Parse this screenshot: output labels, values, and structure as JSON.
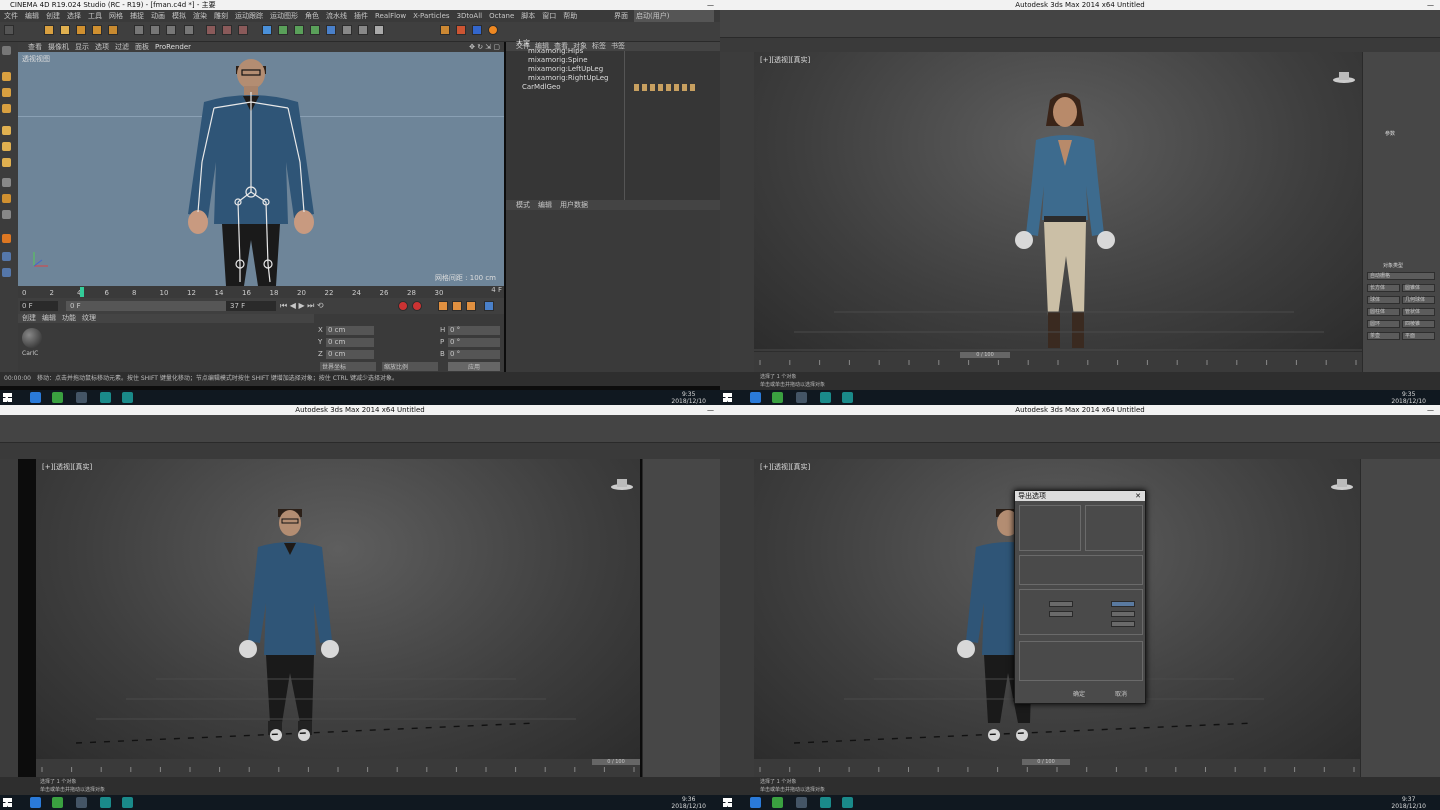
{
  "c4d": {
    "title": "CINEMA 4D R19.024 Studio (RC - R19) - [fman.c4d *] - 主要",
    "menu": [
      "文件",
      "编辑",
      "创建",
      "选择",
      "工具",
      "网格",
      "捕捉",
      "动画",
      "模拟",
      "渲染",
      "雕刻",
      "运动跟踪",
      "运动图形",
      "角色",
      "流水线",
      "插件",
      "RealFlow",
      "X-Particles",
      "3DtoAll",
      "Octane",
      "脚本",
      "窗口",
      "帮助"
    ],
    "layout_label": "界面",
    "layout_value": "启动(用户)",
    "viewport_menu": [
      "查看",
      "摄像机",
      "显示",
      "选项",
      "过滤",
      "面板",
      "ProRender"
    ],
    "viewport_name": "透视视图",
    "grid_spacing": "网格间距 : 100 cm",
    "timeline_ticks": [
      "0",
      "2",
      "4",
      "6",
      "8",
      "10",
      "12",
      "14",
      "16",
      "18",
      "20",
      "22",
      "24",
      "26",
      "28",
      "30"
    ],
    "timeline_end": "4 F",
    "frame_start": "0 F",
    "frame_cur": "0 F",
    "frame_end": "37 F",
    "objects_menu": [
      "文件",
      "编辑",
      "查看",
      "对象",
      "标签",
      "书签"
    ],
    "objects": [
      "大宝",
      "mixamorig:Hips",
      "mixamorig:Spine",
      "mixamorig:LeftUpLeg",
      "mixamorig:RightUpLeg",
      "CarMdlGeo"
    ],
    "attr_menu": [
      "模式",
      "编辑",
      "用户数据"
    ],
    "material_menu": [
      "创建",
      "编辑",
      "功能",
      "纹理"
    ],
    "material_name": "CarIC",
    "coords": {
      "x": "0 cm",
      "y": "0 cm",
      "z": "0 cm",
      "h": "0 °",
      "p": "0 °",
      "b": "0 °"
    },
    "coord_mode1": "世界坐标",
    "coord_mode2": "缩放比例",
    "apply": "应用",
    "status_time": "00:00:00",
    "status_text": "移动：点击并拖动鼠标移动元素。按住 SHIFT 键量化移动；节点编辑模式时按住 SHIFT 键增加选择对象；按住 CTRL 键减少选择对象。",
    "clock_time": "9:35",
    "clock_date": "2018/12/10"
  },
  "max_tr": {
    "title": "Autodesk 3ds Max 2014 x64    Untitled",
    "viewport_label": "[+][透视][真实]",
    "cmd_panel": [
      "参数",
      "对象类型",
      "自动栅格",
      "长方体",
      "圆锥体",
      "球体",
      "几何球体",
      "圆柱体",
      "管状体",
      "圆环",
      "四棱锥",
      "茶壶",
      "平面"
    ],
    "track_ticks": [
      "0",
      "5",
      "10",
      "15",
      "20",
      "25",
      "30",
      "35",
      "40",
      "45",
      "50",
      "55",
      "60",
      "65",
      "70",
      "75",
      "80",
      "85",
      "90",
      "95",
      "100"
    ],
    "frame": "0 / 100",
    "status1": "选择了 1 个对象",
    "status2": "单击或单击并拖动以选择对象",
    "clock_time": "9:35",
    "clock_date": "2018/12/10"
  },
  "max_bl": {
    "title": "Autodesk 3ds Max 2014 x64    Untitled",
    "viewport_label": "[+][透视][真实]",
    "frame": "0 / 100",
    "status1": "选择了 1 个对象",
    "status2": "单击或单击并拖动以选择对象",
    "clock_time": "9:36",
    "clock_date": "2018/12/10"
  },
  "max_br": {
    "title": "Autodesk 3ds Max 2014 x64    Untitled",
    "viewport_label": "[+][透视][真实]",
    "dialog_title": "导出选项",
    "dialog_ok": "确定",
    "dialog_cancel": "取消",
    "frame": "0 / 100",
    "status1": "选择了 1 个对象",
    "status2": "单击或单击并拖动以选择对象",
    "clock_time": "9:37",
    "clock_date": "2018/12/10"
  },
  "colors": {
    "c4d_viewport": "#6e8599",
    "max_bg": "#3e3e3e",
    "shirt_blue": "#2f5577",
    "taskbar": "#101820"
  }
}
